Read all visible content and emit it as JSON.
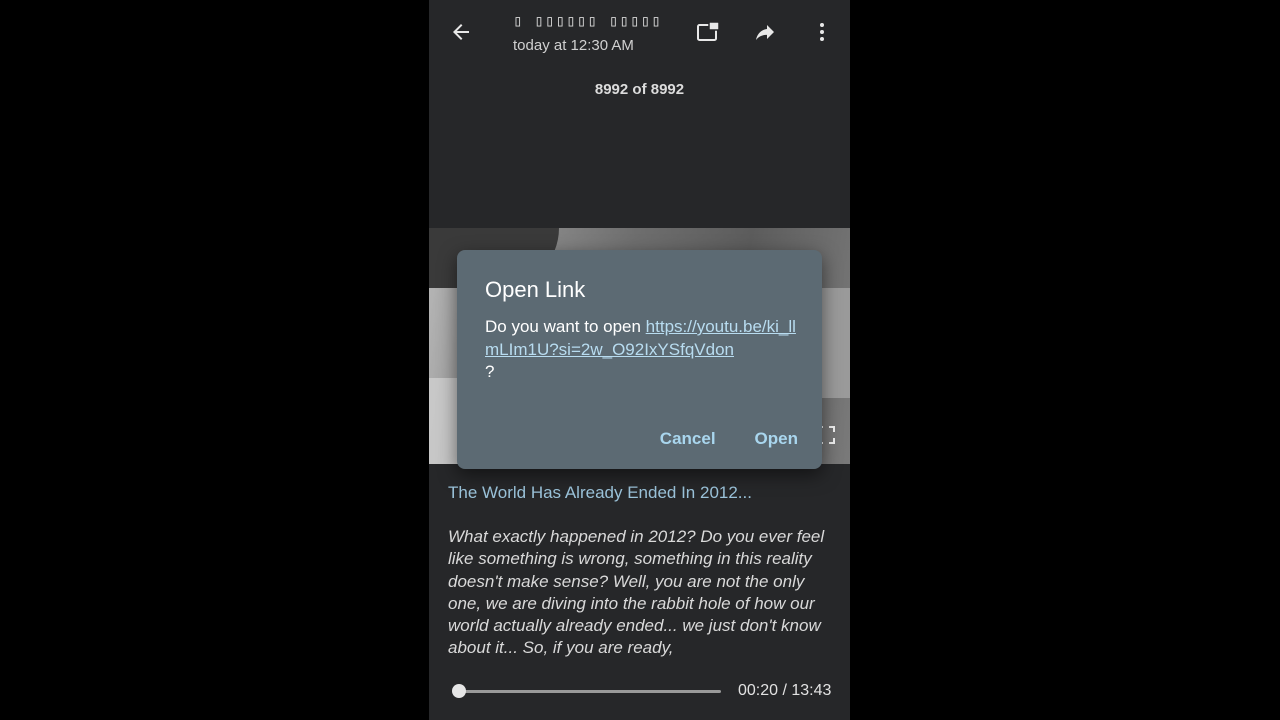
{
  "header": {
    "sender_name": "▯ ▯▯▯▯▯▯ ▯▯▯▯▯   ▯▯",
    "timestamp": "today at 12:30 AM",
    "icons": {
      "back": "arrow-back-icon",
      "pip": "picture-in-picture-icon",
      "share": "share-forward-icon",
      "more": "more-vertical-icon"
    }
  },
  "counter": "8992 of 8992",
  "dialog": {
    "title": "Open Link",
    "prompt": "Do you want to open ",
    "url": "https://youtu.be/ki_llmLIm1U?si=2w_O92IxYSfqVdon",
    "suffix": "?",
    "cancel_label": "Cancel",
    "open_label": "Open"
  },
  "caption": {
    "title": "The World Has Already Ended In 2012...",
    "body": "What exactly happened in 2012? Do you ever feel like something is wrong, something in this reality doesn't make sense? Well, you are not the only one, we are diving into the rabbit hole of how our world actually already ended... we just don't know about it... So, if you are ready,"
  },
  "player": {
    "time": "00:20 / 13:43",
    "progress": 0.024
  },
  "colors": {
    "background": "#262729",
    "dialog": "#5c6a73",
    "link": "#b8dcf0",
    "accent": "#a9d6ee",
    "caption_title": "#9bc3da"
  }
}
